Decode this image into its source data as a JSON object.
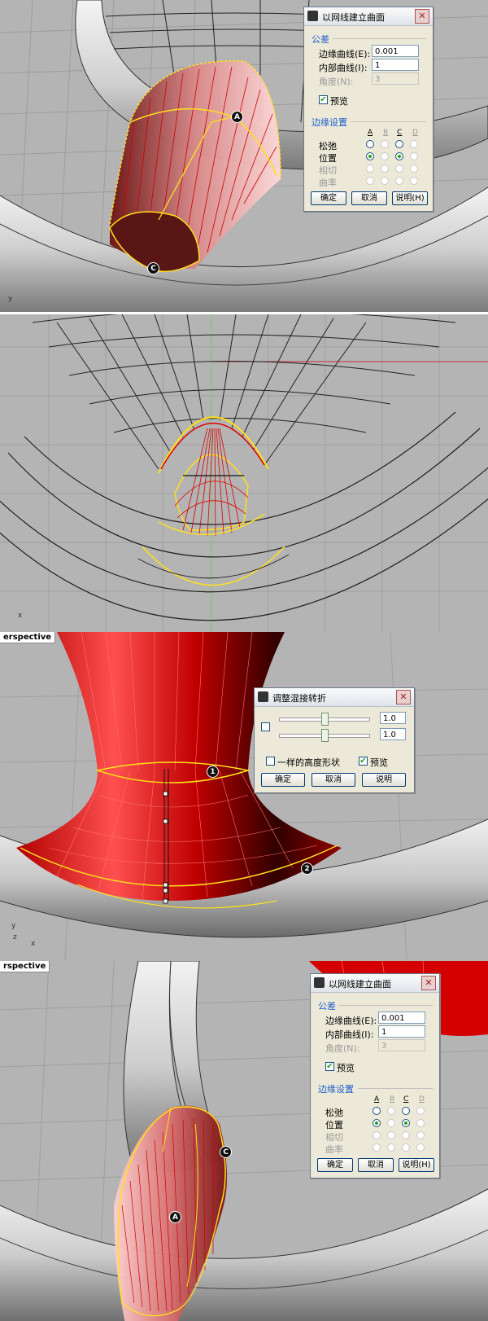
{
  "panels": {
    "p1": {
      "axis_label": "y"
    },
    "p2": {
      "axis_label": "x"
    },
    "p3": {
      "viewport_label": "erspective",
      "axis_z": "z",
      "axis_x": "x",
      "axis_y": "y"
    },
    "p4": {
      "viewport_label": "rspective"
    }
  },
  "markers": {
    "p1_a": "A",
    "p1_c": "C",
    "p3_1": "1",
    "p3_2": "2",
    "p4_c": "C",
    "p4_a": "A"
  },
  "network_dialog": {
    "title": "以网线建立曲面",
    "tolerance_section": "公差",
    "edge_curves_label": "边缘曲线(E):",
    "edge_curves_value": "0.001",
    "inner_curves_label": "内部曲线(I):",
    "inner_curves_value": "1",
    "angle_label": "角度(N):",
    "angle_value": "3",
    "preview_label": "预览",
    "preview_checked": true,
    "edge_settings_section": "边缘设置",
    "columns": [
      "A",
      "B",
      "C",
      "D"
    ],
    "rows": [
      {
        "label": "松弛",
        "enabled": true,
        "selected": []
      },
      {
        "label": "位置",
        "enabled": true,
        "selected": [
          "A",
          "C"
        ]
      },
      {
        "label": "相切",
        "enabled": false,
        "selected": []
      },
      {
        "label": "曲率",
        "enabled": false,
        "selected": []
      }
    ],
    "ok_button": "确定",
    "cancel_button": "取消",
    "help_button": "说明(H)"
  },
  "blend_dialog": {
    "title": "调整混接转折",
    "slider1_value": "1.0",
    "slider2_value": "1.0",
    "same_height_label": "一样的高度形状",
    "same_height_checked": false,
    "preview_label": "预览",
    "preview_checked": true,
    "ok_button": "确定",
    "cancel_button": "取消",
    "help_button": "说明"
  },
  "colors": {
    "viewport_bg": "#b4b4b4",
    "surface_red": "#d40000",
    "curve_yellow": "#ffe11a",
    "dialog_bg": "#ece9d8",
    "section_blue": "#1a5ccc"
  }
}
